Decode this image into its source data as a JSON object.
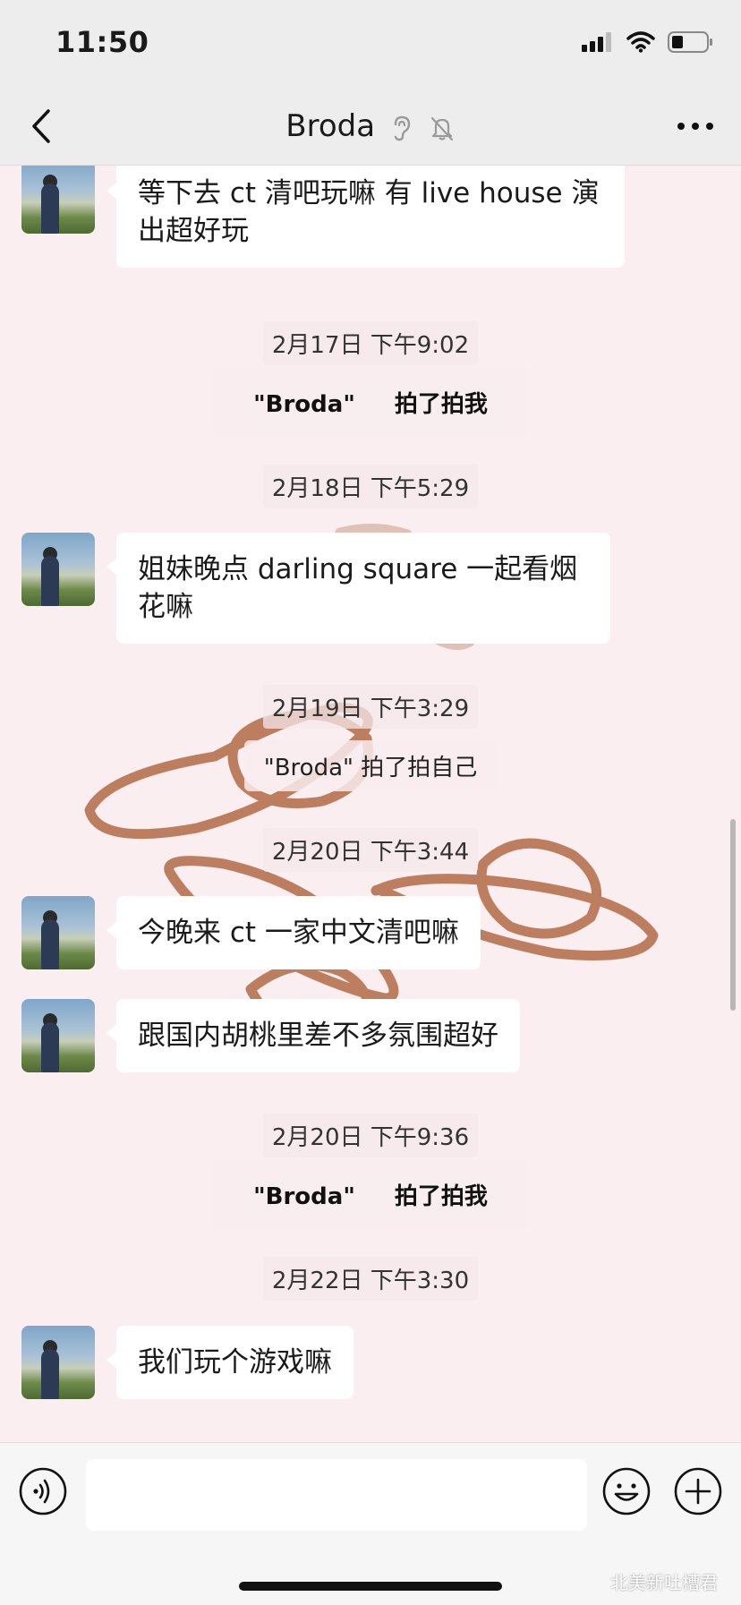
{
  "status": {
    "time": "11:50"
  },
  "header": {
    "title": "Broda"
  },
  "messages": [
    {
      "type": "text",
      "text1": "等下去 ct 清吧玩嘛 有 live house 演",
      "text2": "出超好玩"
    },
    {
      "type": "time",
      "text": "2月17日 下午9:02"
    },
    {
      "type": "pat",
      "name": "\"Broda\"",
      "action": " 拍了拍我"
    },
    {
      "type": "time",
      "text": "2月18日 下午5:29"
    },
    {
      "type": "text",
      "text1": "姐妹晚点 darling square 一起看烟",
      "text2": "花嘛"
    },
    {
      "type": "time",
      "text": "2月19日 下午3:29"
    },
    {
      "type": "pat",
      "text": "\"Broda\" 拍了拍自己"
    },
    {
      "type": "time",
      "text": "2月20日 下午3:44"
    },
    {
      "type": "text",
      "text": "今晚来 ct 一家中文清吧嘛"
    },
    {
      "type": "text",
      "text": "跟国内胡桃里差不多氛围超好"
    },
    {
      "type": "time",
      "text": "2月20日 下午9:36"
    },
    {
      "type": "pat",
      "name": "\"Broda\"",
      "action": " 拍了拍我"
    },
    {
      "type": "time",
      "text": "2月22日 下午3:30"
    },
    {
      "type": "text",
      "text": "我们玩个游戏嘛"
    }
  ],
  "watermark": "北美新吐槽君",
  "colors": {
    "background": "#fbeef0",
    "bar": "#ededed",
    "bubble": "#ffffff",
    "doodle": "#b5714e"
  },
  "icons": [
    "back-chevron-icon",
    "ear-icon",
    "mute-bell-icon",
    "more-icon",
    "voice-icon",
    "emoji-icon",
    "plus-icon"
  ]
}
